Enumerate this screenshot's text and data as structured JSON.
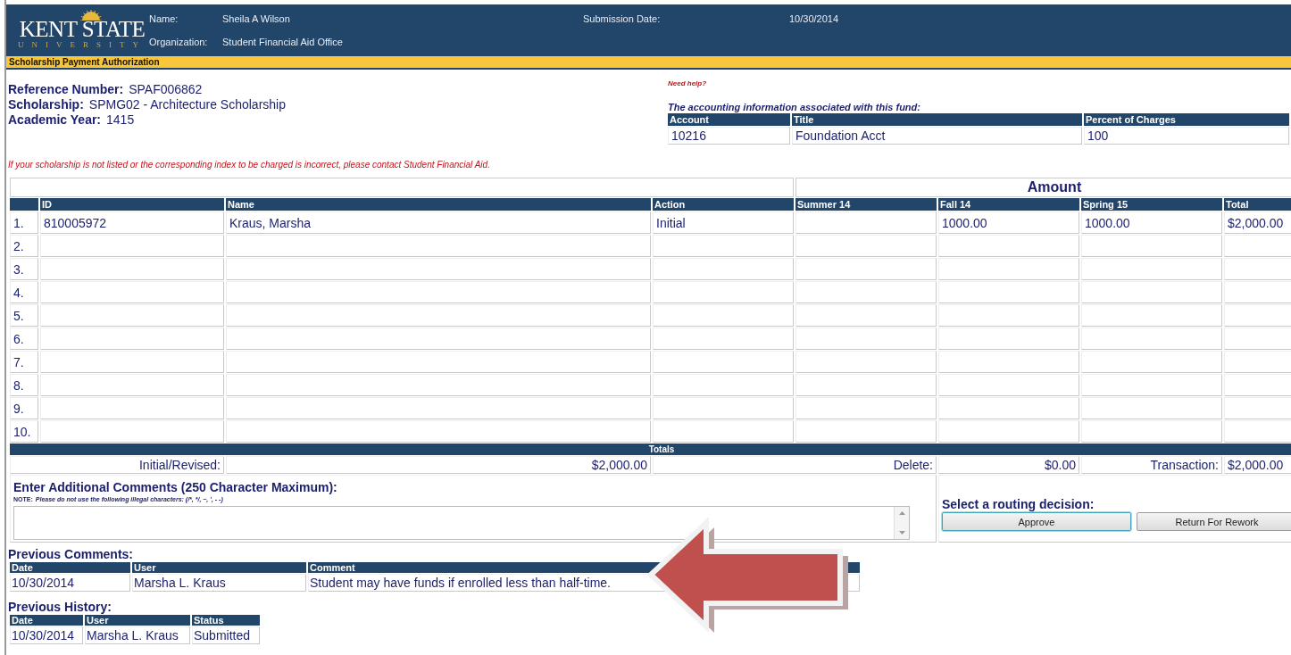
{
  "header": {
    "logo": {
      "wordmark": "KENT STATE",
      "subtitle": "UNIVERSITY"
    },
    "name_label": "Name:",
    "name": "Sheila A Wilson",
    "organization_label": "Organization:",
    "organization": "Student Financial Aid Office",
    "submission_label": "Submission Date:",
    "submission_date": "10/30/2014"
  },
  "page_title": "Scholarship Payment Authorization",
  "details": [
    {
      "label": "Reference Number:",
      "value": "SPAF006862"
    },
    {
      "label": "Scholarship:",
      "value": "SPMG02 - Architecture Scholarship"
    },
    {
      "label": "Academic Year:",
      "value": "1415"
    }
  ],
  "help_link": "Need help?",
  "accounting": {
    "title": "The accounting information associated with this fund:",
    "columns": [
      "Account",
      "Title",
      "Percent of Charges"
    ],
    "rows": [
      [
        "10216",
        "Foundation Acct",
        "100"
      ]
    ]
  },
  "notice": "If your scholarship is not listed or the corresponding index to be charged is incorrect, please contact Student Financial Aid.",
  "awards": {
    "group_heading": "Amount",
    "columns": [
      "ID",
      "Name",
      "Action",
      "Summer 14",
      "Fall 14",
      "Spring 15",
      "Total"
    ],
    "rows": [
      {
        "number": "1.",
        "cells": [
          "810005972",
          "Kraus, Marsha",
          "Initial",
          "",
          "1000.00",
          "1000.00",
          "$2,000.00"
        ]
      },
      {
        "number": "2."
      },
      {
        "number": "3."
      },
      {
        "number": "4."
      },
      {
        "number": "5."
      },
      {
        "number": "6."
      },
      {
        "number": "7."
      },
      {
        "number": "8."
      },
      {
        "number": "9."
      },
      {
        "number": "10."
      }
    ],
    "totals_heading": "Totals",
    "totals": {
      "initial_label": "Initial/Revised:",
      "initial": "$2,000.00",
      "delete_label": "Delete:",
      "delete": "$0.00",
      "transaction_label": "Transaction:",
      "transaction": "$2,000.00"
    }
  },
  "comments": {
    "title": "Enter Additional Comments (250 Character Maximum):",
    "note_prefix": "NOTE:",
    "note": "Please do not use the following illegal characters: (/*, */, ~, ', - -)"
  },
  "routing": {
    "title": "Select a routing decision:",
    "buttons": [
      {
        "label": "Approve",
        "focused": true
      },
      {
        "label": "Return For Rework",
        "focused": false
      }
    ]
  },
  "previous_comments": {
    "title": "Previous Comments:",
    "columns": [
      "Date",
      "User",
      "Comment"
    ],
    "rows": [
      [
        "10/30/2014",
        "Marsha L. Kraus",
        "Student may have funds if enrolled less than half-time."
      ]
    ]
  },
  "previous_history": {
    "title": "Previous History:",
    "columns": [
      "Date",
      "User",
      "Status"
    ],
    "rows": [
      [
        "10/30/2014",
        "Marsha L. Kraus",
        "Submitted"
      ]
    ]
  },
  "annotation": {
    "kind": "arrow"
  }
}
